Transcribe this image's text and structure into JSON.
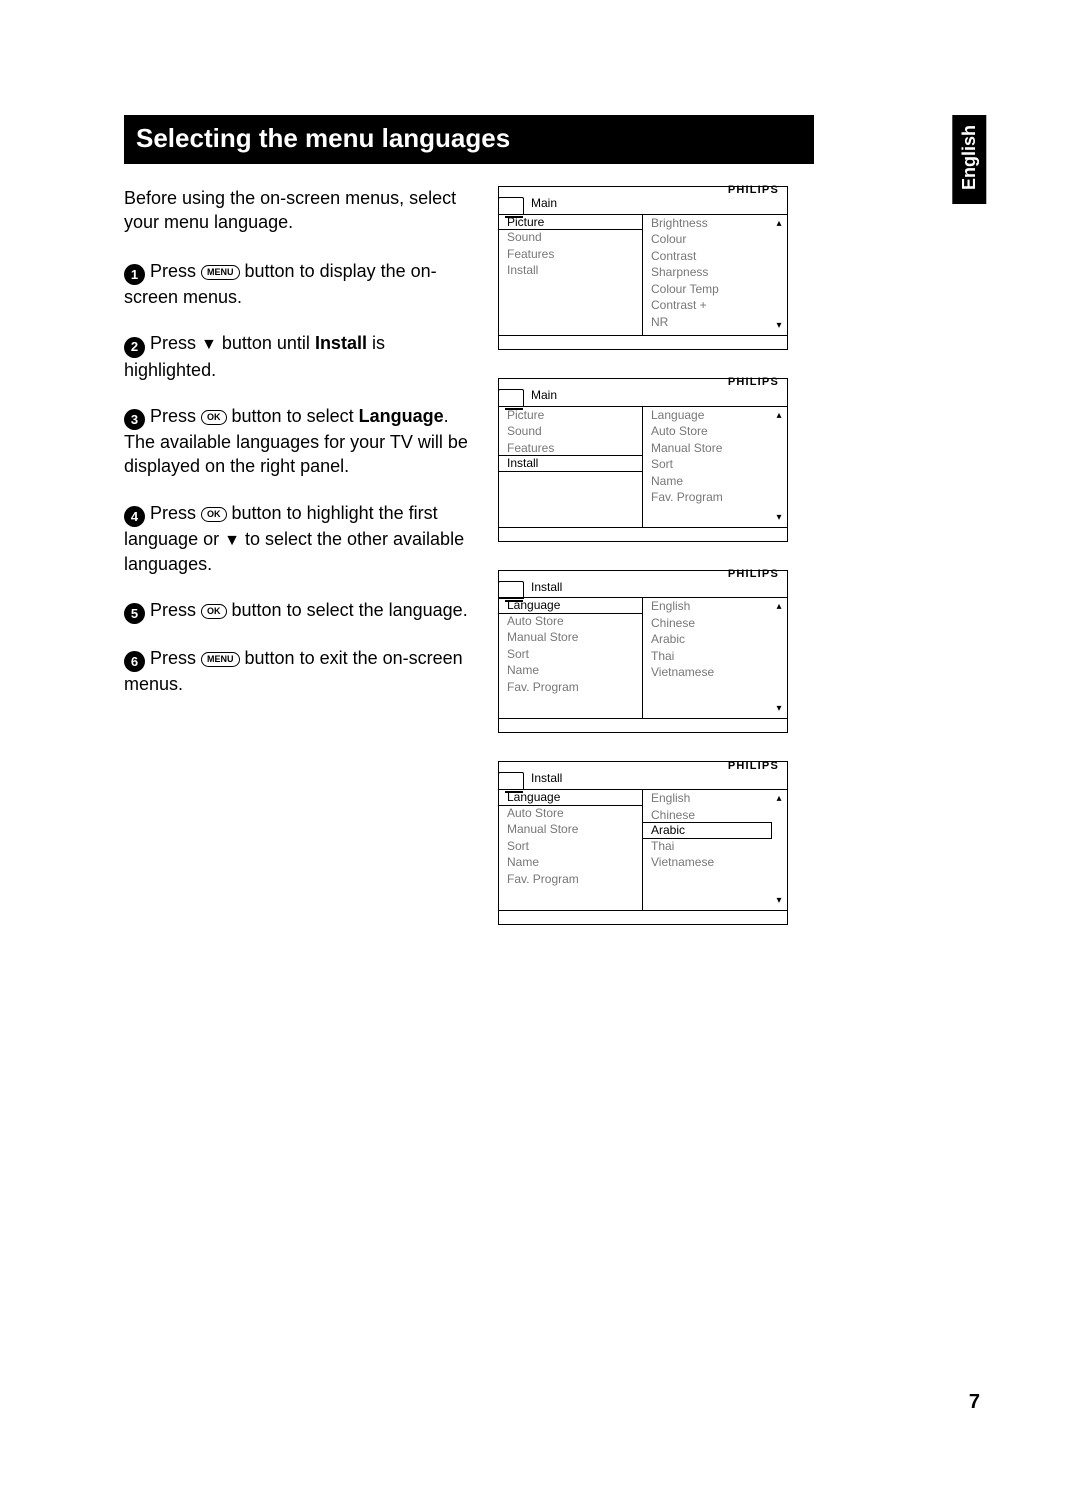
{
  "page_title": "Selecting the menu languages",
  "lang_tab": "English",
  "intro": "Before using the on-screen menus, select your menu language.",
  "steps": [
    {
      "num": "1",
      "pre": " Press ",
      "btn": "MENU",
      "post": " button to display the on-screen menus."
    },
    {
      "num": "2",
      "pre": " Press ",
      "sym": "▼",
      "post1": " button until ",
      "bold": "Install",
      "post2": " is highlighted."
    },
    {
      "num": "3",
      "pre": " Press ",
      "btn": "OK",
      "post1": " button to select ",
      "bold": "Language",
      "post2": ". The available languages for your TV will be displayed on the right panel."
    },
    {
      "num": "4",
      "pre": " Press ",
      "btn": "OK",
      "post1": " button to highlight the first language or ",
      "sym": "▼",
      "post2": " to select the other available languages."
    },
    {
      "num": "5",
      "pre": "  Press ",
      "btn": "OK",
      "post": " button to select the language."
    },
    {
      "num": "6",
      "pre": " Press ",
      "btn": "MENU",
      "post": " button to exit the on-screen menus."
    }
  ],
  "brand": "PHILIPS",
  "menus": [
    {
      "title": "Main",
      "left": [
        {
          "t": "Picture",
          "boxed": true
        },
        {
          "t": "Sound"
        },
        {
          "t": "Features"
        },
        {
          "t": "Install"
        },
        {
          "t": ""
        },
        {
          "t": ""
        },
        {
          "t": ""
        }
      ],
      "right": [
        {
          "t": "Brightness"
        },
        {
          "t": "Colour"
        },
        {
          "t": "Contrast"
        },
        {
          "t": "Sharpness"
        },
        {
          "t": "Colour Temp"
        },
        {
          "t": "Contrast +"
        },
        {
          "t": "NR"
        }
      ]
    },
    {
      "title": "Main",
      "left": [
        {
          "t": "Picture"
        },
        {
          "t": "Sound"
        },
        {
          "t": "Features"
        },
        {
          "t": "Install",
          "boxed": true
        },
        {
          "t": ""
        },
        {
          "t": ""
        },
        {
          "t": ""
        }
      ],
      "right": [
        {
          "t": "Language"
        },
        {
          "t": "Auto Store"
        },
        {
          "t": "Manual Store"
        },
        {
          "t": "Sort"
        },
        {
          "t": "Name"
        },
        {
          "t": "Fav. Program"
        },
        {
          "t": ""
        }
      ]
    },
    {
      "title": "Install",
      "left": [
        {
          "t": "Language",
          "boxed": true
        },
        {
          "t": "Auto Store"
        },
        {
          "t": "Manual Store"
        },
        {
          "t": "Sort"
        },
        {
          "t": "Name"
        },
        {
          "t": "Fav. Program"
        },
        {
          "t": ""
        }
      ],
      "right": [
        {
          "t": "English"
        },
        {
          "t": "Chinese"
        },
        {
          "t": "Arabic"
        },
        {
          "t": "Thai"
        },
        {
          "t": "Vietnamese"
        },
        {
          "t": ""
        },
        {
          "t": ""
        }
      ]
    },
    {
      "title": "Install",
      "left": [
        {
          "t": "Language",
          "boxed": true
        },
        {
          "t": "Auto Store"
        },
        {
          "t": "Manual Store"
        },
        {
          "t": "Sort"
        },
        {
          "t": "Name"
        },
        {
          "t": "Fav. Program"
        },
        {
          "t": ""
        }
      ],
      "right": [
        {
          "t": "English"
        },
        {
          "t": "Chinese"
        },
        {
          "t": "Arabic",
          "boxed": true
        },
        {
          "t": "Thai"
        },
        {
          "t": "Vietnamese"
        },
        {
          "t": ""
        },
        {
          "t": ""
        }
      ]
    }
  ],
  "page_number": "7",
  "arrows": {
    "up": "▴",
    "down": "▾"
  }
}
